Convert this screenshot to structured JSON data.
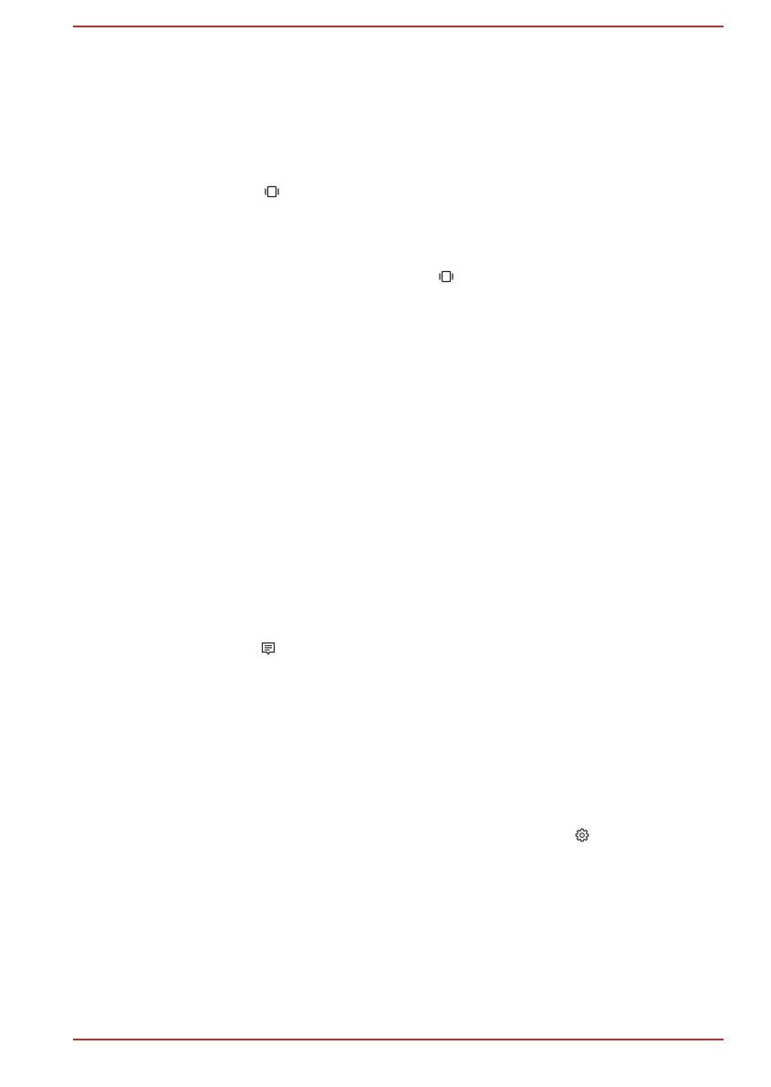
{
  "document": {
    "accent_color": "#a33a3a",
    "text_color": "#222222"
  },
  "icons": [
    {
      "name": "vibrate-icon"
    },
    {
      "name": "vibrate-icon"
    },
    {
      "name": "message-icon"
    },
    {
      "name": "gear-icon"
    }
  ]
}
